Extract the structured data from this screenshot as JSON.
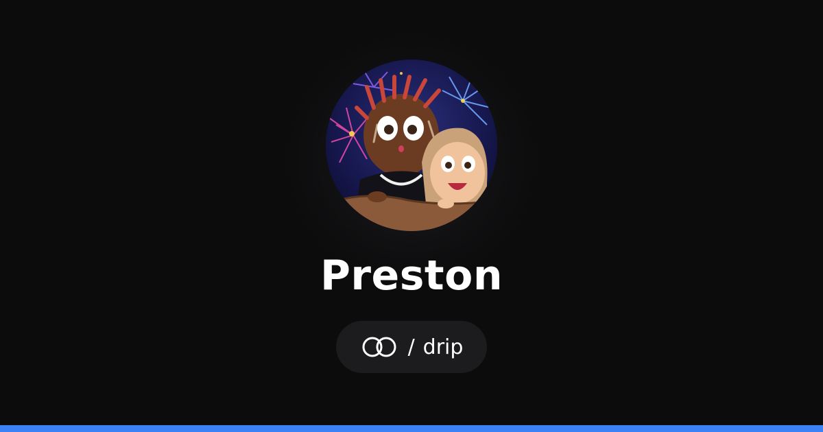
{
  "profile": {
    "name": "Preston",
    "avatar_description_icon": "profile-avatar-illustration"
  },
  "brand": {
    "icon": "drip-logo-icon",
    "separator": "/",
    "label": "drip"
  },
  "colors": {
    "background": "#0c0c0d",
    "pill_background": "#1c1c1e",
    "accent_bar": "#3a82f6",
    "text": "#ffffff"
  }
}
